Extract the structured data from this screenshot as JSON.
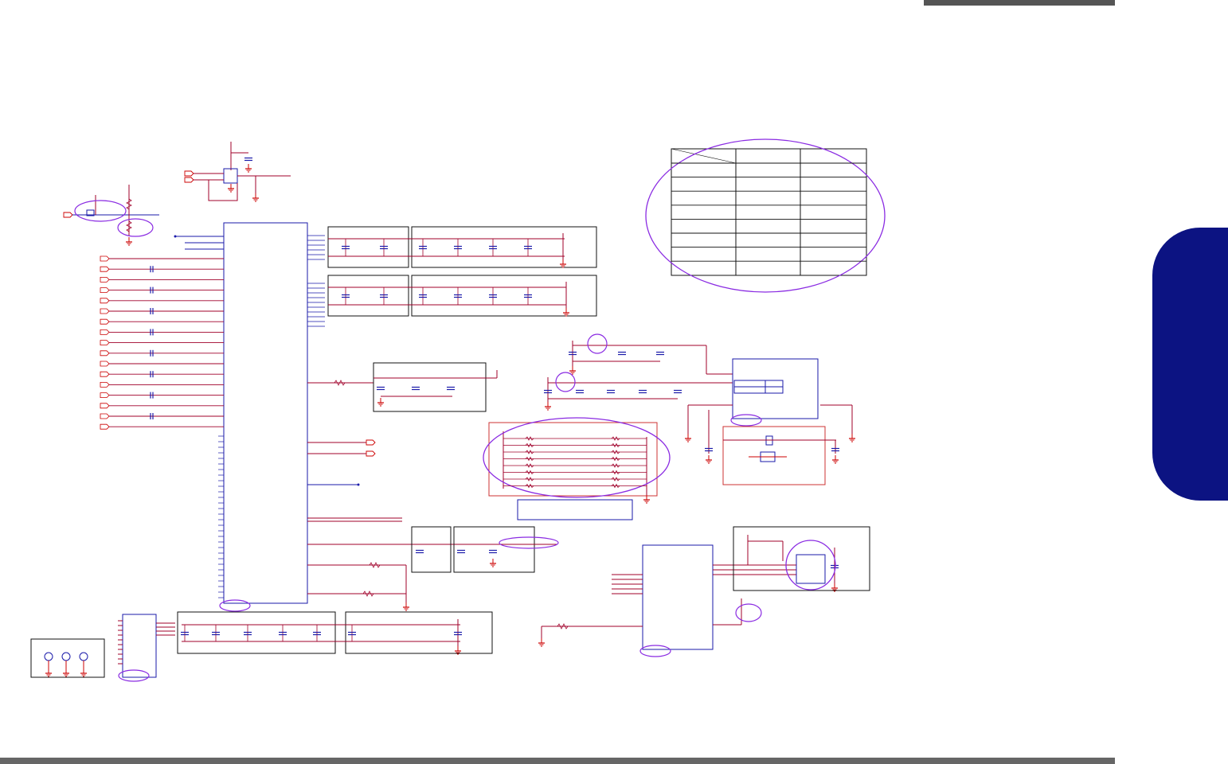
{
  "page": {
    "header_bar_color": "#555555",
    "footer_bar_color": "#666666",
    "side_tab_color": "#0c1382"
  },
  "schematic": {
    "wire_color": "#a0002a",
    "part_color": "#1a1aaa",
    "ground_color": "#cc0000",
    "frame_color": "#111111",
    "highlight_color": "#8a2be2"
  },
  "table": {
    "rows": 9,
    "cols": 3
  }
}
